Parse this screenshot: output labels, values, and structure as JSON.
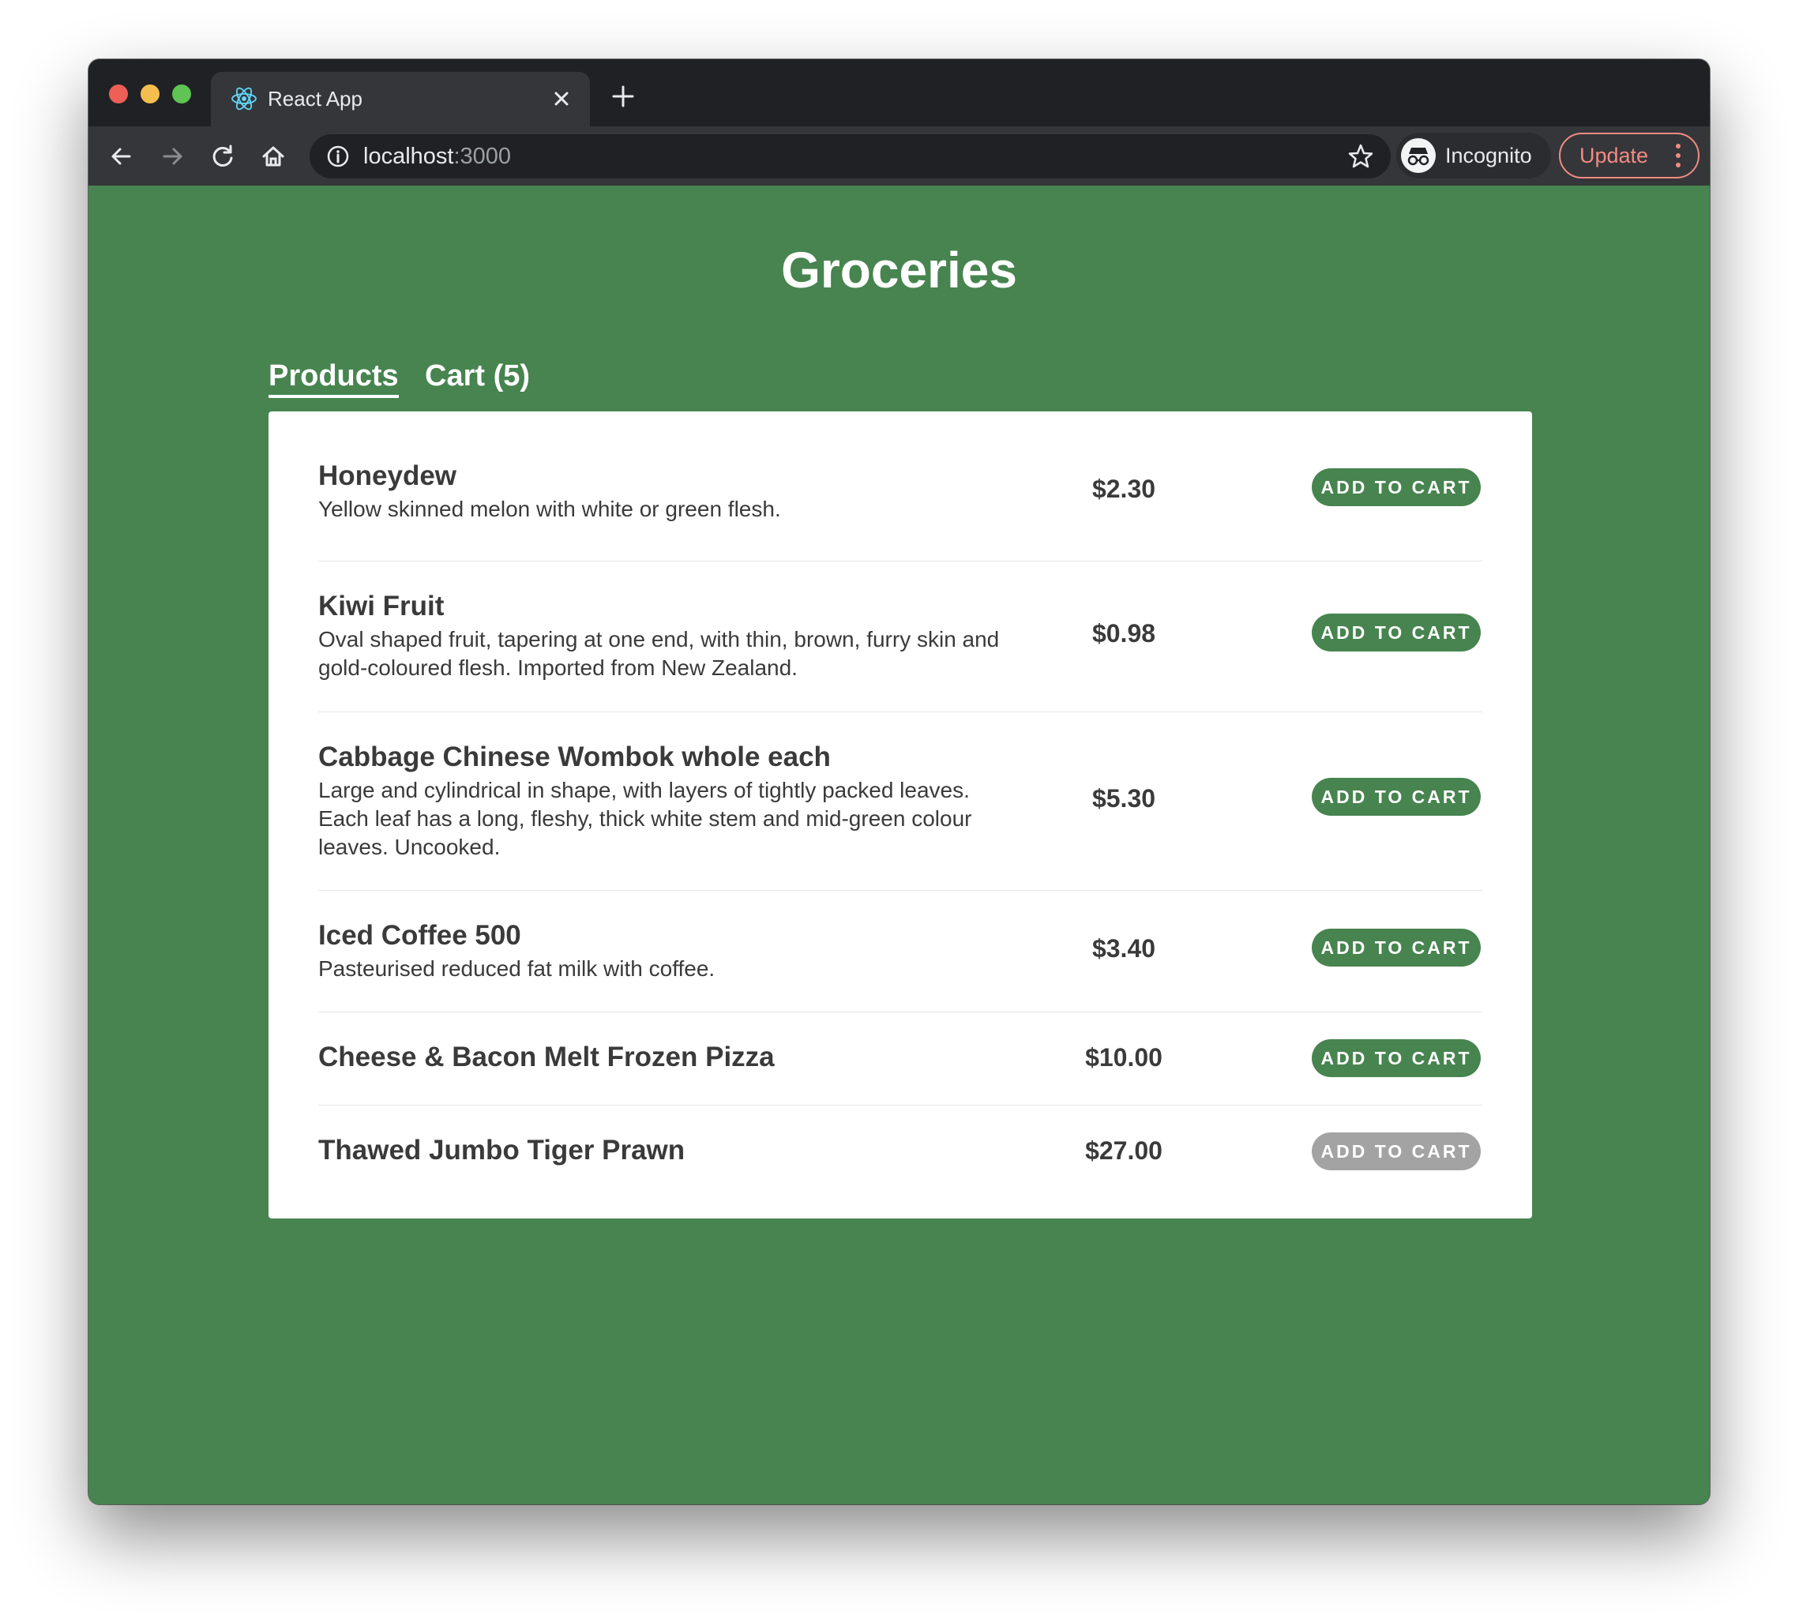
{
  "browser": {
    "tab_title": "React App",
    "url_host": "localhost",
    "url_port": ":3000",
    "profile_label": "Incognito",
    "update_label": "Update"
  },
  "page": {
    "title": "Groceries",
    "nav": {
      "products_label": "Products",
      "cart_label": "Cart (5)"
    }
  },
  "products": [
    {
      "name": "Honeydew",
      "description": "Yellow skinned melon with white or green flesh.",
      "price": "$2.30",
      "button_label": "ADD TO CART"
    },
    {
      "name": "Kiwi Fruit",
      "description": "Oval shaped fruit, tapering at one end, with thin, brown, furry skin and gold-coloured flesh. Imported from New Zealand.",
      "price": "$0.98",
      "button_label": "ADD TO CART"
    },
    {
      "name": "Cabbage Chinese Wombok whole each",
      "description": "Large and cylindrical in shape, with layers of tightly packed leaves. Each leaf has a long, fleshy, thick white stem and mid-green colour leaves. Uncooked.",
      "price": "$5.30",
      "button_label": "ADD TO CART"
    },
    {
      "name": "Iced Coffee 500",
      "description": "Pasteurised reduced fat milk with coffee.",
      "price": "$3.40",
      "button_label": "ADD TO CART"
    },
    {
      "name": "Cheese & Bacon Melt Frozen Pizza",
      "description": "",
      "price": "$10.00",
      "button_label": "ADD TO CART"
    },
    {
      "name": "Thawed Jumbo Tiger Prawn",
      "description": "",
      "price": "$27.00",
      "button_label": "ADD TO CART"
    }
  ],
  "colors": {
    "page_background": "#47844f",
    "button_green": "#47844f",
    "button_disabled": "#a3a3a3",
    "browser_chrome": "#202124"
  }
}
